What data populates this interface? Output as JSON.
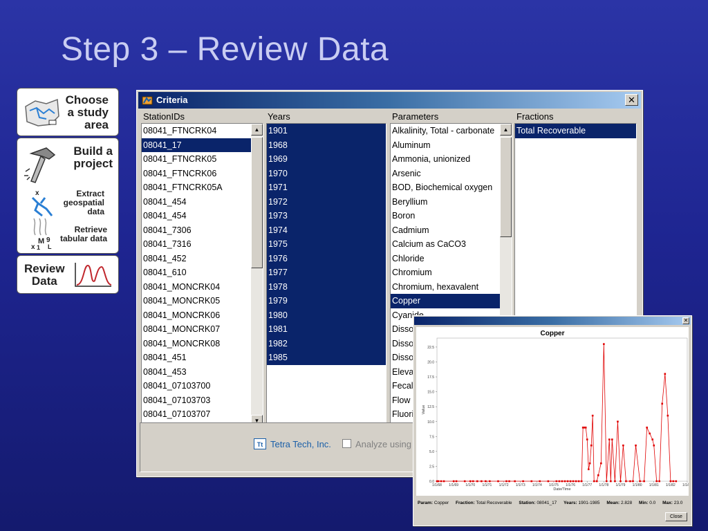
{
  "slide_title": "Step 3 – Review Data",
  "steps": {
    "choose": "Choose a study area",
    "choose_lines": [
      "Choose",
      "a study",
      "area"
    ],
    "build_lines": [
      "Build a",
      "project"
    ],
    "extract_lines": [
      "Extract",
      "geospatial",
      "data"
    ],
    "retrieve_lines": [
      "Retrieve",
      "tabular data"
    ],
    "review_lines": [
      "Review",
      "Data"
    ]
  },
  "criteria": {
    "title": "Criteria",
    "close_glyph": "✕",
    "columns": {
      "stations_label": "StationIDs",
      "years_label": "Years",
      "params_label": "Parameters",
      "fractions_label": "Fractions"
    },
    "stations": [
      "08041_FTNCRK04",
      "08041_17",
      "08041_FTNCRK05",
      "08041_FTNCRK06",
      "08041_FTNCRK05A",
      "08041_454",
      "08041_454",
      "08041_7306",
      "08041_7316",
      "08041_452",
      "08041_610",
      "08041_MONCRK04",
      "08041_MONCRK05",
      "08041_MONCRK06",
      "08041_MONCRK07",
      "08041_MONCRK08",
      "08041_451",
      "08041_453",
      "08041_07103700",
      "08041_07103703",
      "08041_07103707"
    ],
    "selected_station_index": 1,
    "years": [
      "1901",
      "1968",
      "1969",
      "1970",
      "1971",
      "1972",
      "1973",
      "1974",
      "1975",
      "1976",
      "1977",
      "1978",
      "1979",
      "1980",
      "1981",
      "1982",
      "1985"
    ],
    "parameters": [
      "Alkalinity, Total - carbonate",
      "Aluminum",
      "Ammonia, unionized",
      "Arsenic",
      "BOD, Biochemical oxygen",
      "Beryllium",
      "Boron",
      "Cadmium",
      "Calcium as CaCO3",
      "Chloride",
      "Chromium",
      "Chromium, hexavalent",
      "Copper",
      "Cyanide",
      "Disso",
      "Disso",
      "Disso",
      "Eleva",
      "Fecal",
      "Flow",
      "Fluori"
    ],
    "selected_parameter_index": 12,
    "fractions": [
      "Total Recoverable"
    ],
    "selected_fraction_index": 0,
    "company_link": "Tetra Tech, Inc.",
    "company_logo_text": "Tt",
    "analyze_label": "Analyze using"
  },
  "chart_window": {
    "close_glyph": "✕",
    "summary": {
      "param_label": "Param:",
      "param_value": "Copper",
      "fraction_label": "Fraction:",
      "fraction_value": "Total Recoverable",
      "station_label": "Station:",
      "station_value": "08041_17",
      "years_label": "Years:",
      "years_value": "1901-1985",
      "mean_label": "Mean:",
      "mean_value": "2.828",
      "min_label": "Min:",
      "min_value": "0.0",
      "max_label": "Max:",
      "max_value": "23.0"
    },
    "close_button": "Close"
  },
  "chart_data": {
    "type": "line",
    "title": "Copper",
    "xlabel": "Date/Time",
    "ylabel": "Value",
    "ylim": [
      0,
      24
    ],
    "yticks": [
      "0.0",
      "2.5",
      "5.0",
      "7.5",
      "10.0",
      "12.5",
      "15.0",
      "17.5",
      "20.0",
      "22.5"
    ],
    "xticks": [
      "1/1/68",
      "1/1/69",
      "1/1/70",
      "1/1/71",
      "1/1/72",
      "1/1/73",
      "1/1/74",
      "1/1/75",
      "1/1/76",
      "1/1/77",
      "1/1/78",
      "1/1/79",
      "1/1/80",
      "1/1/81",
      "1/1/82",
      "1/1/83"
    ],
    "xlim": [
      "1968-01-01",
      "1983-01-01"
    ],
    "color": "#e00000",
    "series": [
      {
        "x": [
          "1968-01-01",
          "1968-02-01",
          "1968-04-01",
          "1968-06-01",
          "1969-01-01",
          "1969-03-01",
          "1969-09-01",
          "1970-01-01",
          "1970-03-01",
          "1970-06-01",
          "1970-09-01",
          "1970-12-01",
          "1971-03-01",
          "1971-09-01",
          "1972-03-01",
          "1972-05-01",
          "1972-09-01",
          "1973-03-01",
          "1973-09-01",
          "1974-03-01",
          "1974-09-01",
          "1975-03-01",
          "1975-05-01",
          "1975-07-01",
          "1975-09-01",
          "1975-11-01",
          "1976-01-01",
          "1976-03-01",
          "1976-05-01",
          "1976-07-01",
          "1976-09-01",
          "1976-10-01",
          "1976-11-01",
          "1976-12-01",
          "1977-01-01",
          "1977-02-01",
          "1977-03-01",
          "1977-04-01",
          "1977-05-01",
          "1977-06-01",
          "1977-08-01",
          "1977-09-01",
          "1977-11-01",
          "1978-01-01",
          "1978-03-01",
          "1978-05-01",
          "1978-06-01",
          "1978-07-01",
          "1978-09-01",
          "1978-11-01",
          "1979-01-01",
          "1979-03-01",
          "1979-05-01",
          "1979-08-01",
          "1979-10-01",
          "1979-12-01",
          "1980-03-01",
          "1980-06-01",
          "1980-08-01",
          "1980-10-01",
          "1980-12-01",
          "1981-01-01",
          "1981-03-01",
          "1981-05-01",
          "1981-07-01",
          "1981-09-01",
          "1981-11-01",
          "1982-01-01",
          "1982-03-01",
          "1982-05-01"
        ],
        "values": [
          0,
          0,
          0,
          0,
          0,
          0,
          0,
          0,
          0,
          0,
          0,
          0,
          0,
          0,
          0,
          0,
          0,
          0,
          0,
          0,
          0,
          0,
          0,
          0,
          0,
          0,
          0,
          0,
          0,
          0,
          0,
          9,
          9,
          9,
          7,
          2,
          3,
          6,
          11,
          0,
          0,
          1,
          3,
          23,
          0,
          7,
          0,
          7,
          0,
          10,
          0,
          6,
          0,
          0,
          0,
          6,
          0,
          0,
          9,
          8,
          7,
          6,
          0,
          0,
          13,
          18,
          11,
          0,
          0,
          0
        ]
      }
    ]
  }
}
